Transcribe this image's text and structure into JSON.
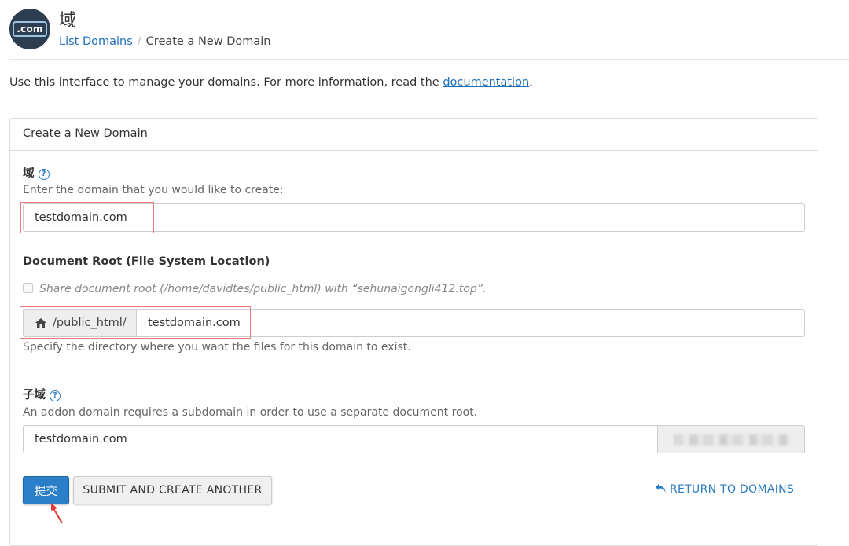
{
  "header": {
    "logo_text": ".com",
    "title": "域",
    "breadcrumb": {
      "link": "List Domains",
      "separator": "/",
      "current": "Create a New Domain"
    }
  },
  "intro": {
    "text": "Use this interface to manage your domains. For more information, read the ",
    "link": "documentation",
    "end": "."
  },
  "panel": {
    "title": "Create a New Domain",
    "domain": {
      "label": "域",
      "help": "?",
      "hint": "Enter the domain that you would like to create:",
      "value": "testdomain.com"
    },
    "docroot": {
      "label": "Document Root (File System Location)",
      "share_text": "Share document root (/home/davidtes/public_html) with “sehunaigongli412.top”.",
      "prefix": "/public_html/",
      "value": "testdomain.com",
      "hint": "Specify the directory where you want the files for this domain to exist."
    },
    "subdomain": {
      "label": "子域",
      "help": "?",
      "hint": "An addon domain requires a subdomain in order to use a separate document root.",
      "value": "testdomain.com"
    },
    "buttons": {
      "submit": "提交",
      "submit_another": "SUBMIT AND CREATE ANOTHER",
      "return": "RETURN TO DOMAINS"
    }
  },
  "colors": {
    "accent": "#2a7fc8",
    "link": "#1f6fb8",
    "highlight": "#e57b7b"
  }
}
